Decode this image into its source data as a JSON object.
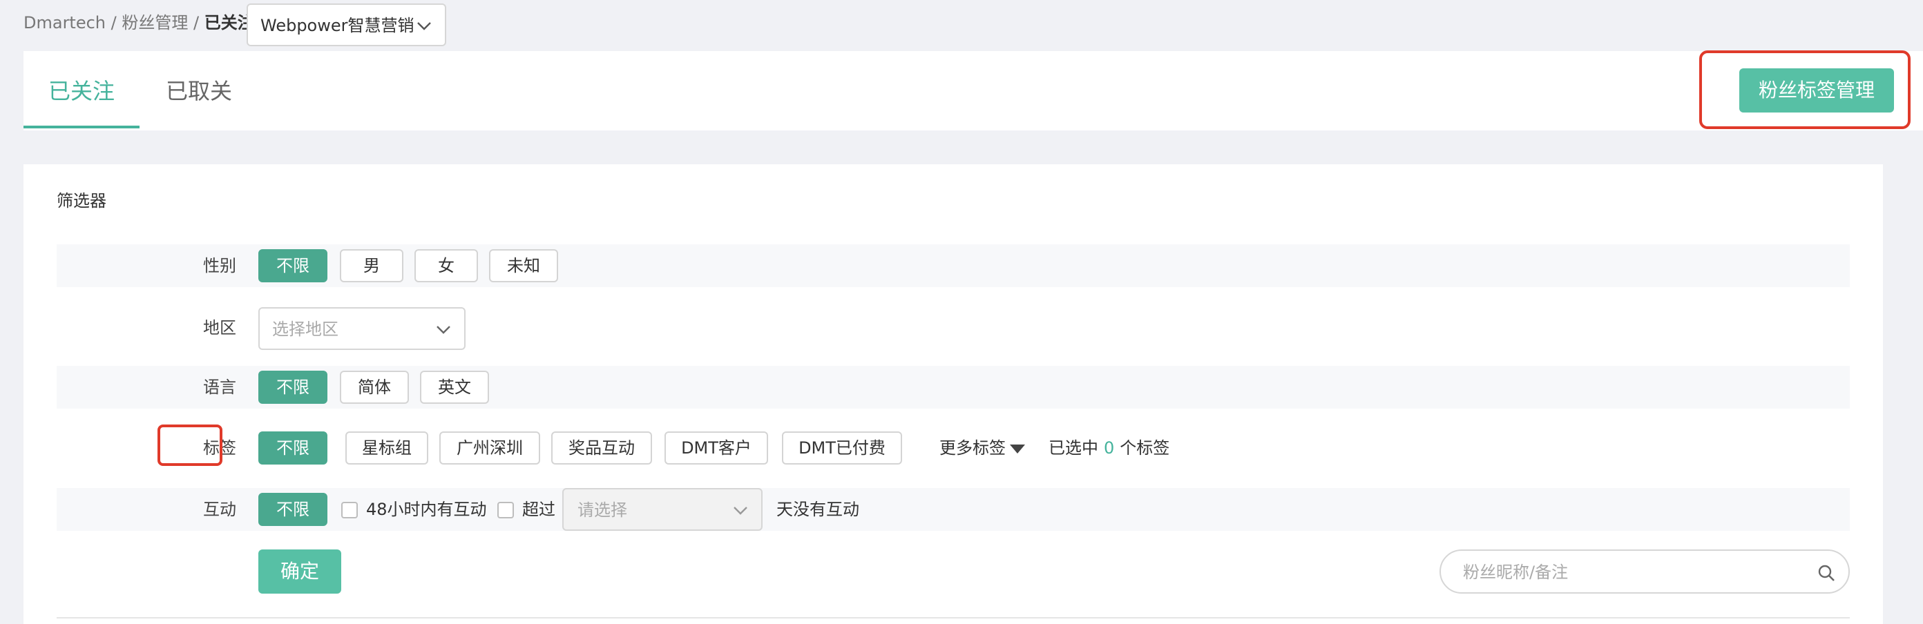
{
  "breadcrumb": {
    "root": "Dmartech",
    "sep1": " / ",
    "section": "粉丝管理",
    "sep2": " / ",
    "current": "已关注"
  },
  "account_select": {
    "value": "Webpower智慧营销",
    "icon": "chevron-down-icon"
  },
  "tabs": [
    {
      "label": "已关注",
      "active": true
    },
    {
      "label": "已取关",
      "active": false
    }
  ],
  "header": {
    "tag_manage_button": "粉丝标签管理"
  },
  "filter": {
    "title": "筛选器",
    "gender": {
      "label": "性别",
      "options": [
        "不限",
        "男",
        "女",
        "未知"
      ],
      "selected": "不限"
    },
    "region": {
      "label": "地区",
      "placeholder": "选择地区"
    },
    "language": {
      "label": "语言",
      "options": [
        "不限",
        "简体",
        "英文"
      ],
      "selected": "不限"
    },
    "tags": {
      "label": "标签",
      "options": [
        "不限",
        "星标组",
        "广州深圳",
        "奖品互动",
        "DMT客户",
        "DMT已付费"
      ],
      "selected": "不限",
      "more_label": "更多标签",
      "selected_prefix": "已选中",
      "selected_count": "0",
      "selected_suffix": "个标签"
    },
    "interaction": {
      "label": "互动",
      "unlimited": "不限",
      "within48h": "48小时内有互动",
      "over": "超过",
      "days_placeholder": "请选择",
      "days_suffix": "天没有互动"
    },
    "confirm_button": "确定",
    "search_placeholder": "粉丝昵称/备注"
  },
  "colors": {
    "accent": "#45b39c",
    "button": "#57c0a5",
    "chip_selected": "#4aa88f",
    "highlight_box": "#e03a2a"
  }
}
